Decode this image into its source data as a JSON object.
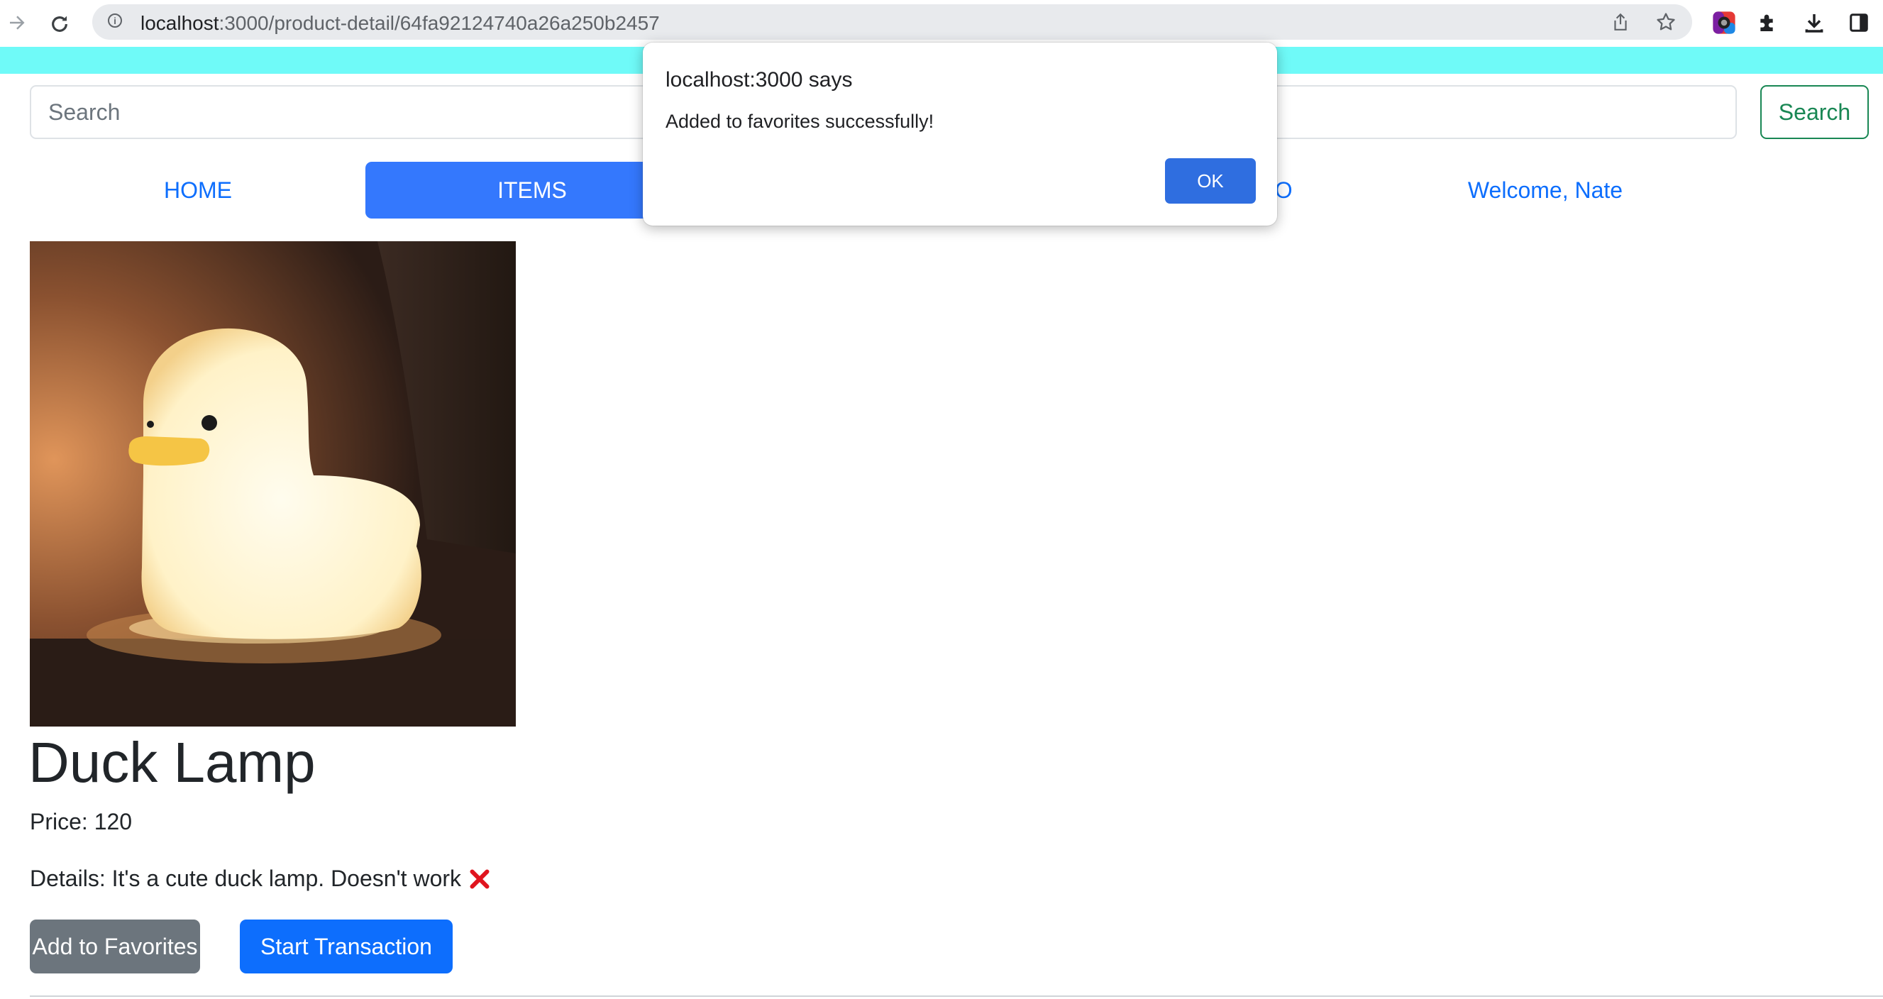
{
  "browser": {
    "url_host": "localhost",
    "url_path": ":3000/product-detail/64fa92124740a26a250b2457",
    "icons": [
      "forward-arrow-icon",
      "reload-icon",
      "site-info-icon",
      "share-icon",
      "bookmark-star-icon",
      "extension-color-icon",
      "puzzle-extensions-icon",
      "download-icon",
      "side-panel-icon"
    ]
  },
  "colors": {
    "banner": "#6ffaf8",
    "link": "#0d6efd",
    "active_tab": "#3478fd",
    "search_button": "#198754",
    "favorites_button": "#6c757d",
    "transaction_button": "#0d6efd",
    "dialog_ok": "#2f6ee0"
  },
  "search": {
    "placeholder": "Search",
    "value": "",
    "button_label": "Search"
  },
  "nav": {
    "home": "HOME",
    "items": "ITEMS",
    "info_visible_fragment": "IFO",
    "welcome": "Welcome, Nate",
    "active": "ITEMS"
  },
  "product": {
    "title": "Duck Lamp",
    "price_text": "Price: 120",
    "details_text": "Details: It's a cute duck lamp. Doesn't work",
    "details_icon": "red-cross-mark-icon",
    "add_favorites_label": "Add to Favorites",
    "start_transaction_label": "Start Transaction"
  },
  "dialog": {
    "title": "localhost:3000 says",
    "message": "Added to favorites successfully!",
    "ok_label": "OK"
  }
}
